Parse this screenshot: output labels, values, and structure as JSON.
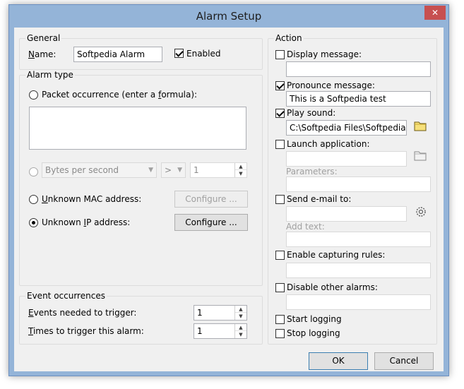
{
  "window": {
    "title": "Alarm Setup",
    "close_glyph": "✕"
  },
  "general": {
    "legend": "General",
    "name_label": "Name:",
    "name_value": "Softpedia Alarm",
    "enabled_label": "Enabled",
    "enabled": true
  },
  "alarm_type": {
    "legend": "Alarm type",
    "packet_label": "Packet occurrence (enter a formula):",
    "formula": "",
    "bytes_select": "Bytes per second",
    "operator_select": ">",
    "threshold_value": "1",
    "unknown_mac_label": "Unknown MAC address:",
    "unknown_mac_configure": "Configure ...",
    "unknown_ip_label": "Unknown IP address:",
    "unknown_ip_configure": "Configure ...",
    "selected": "unknown_ip"
  },
  "event_occurrences": {
    "legend": "Event occurrences",
    "events_label": "Events needed to trigger:",
    "events_value": "1",
    "times_label": "Times to trigger this alarm:",
    "times_value": "1"
  },
  "action": {
    "legend": "Action",
    "display_message_label": "Display message:",
    "display_message_value": "",
    "pronounce_message_label": "Pronounce message:",
    "pronounce_message_value": "This is a Softpedia test",
    "play_sound_label": "Play sound:",
    "play_sound_value": "C:\\Softpedia Files\\Softpedia.wav",
    "launch_app_label": "Launch application:",
    "launch_app_value": "",
    "parameters_label": "Parameters:",
    "parameters_value": "",
    "send_email_label": "Send e-mail to:",
    "send_email_value": "",
    "add_text_label": "Add text:",
    "add_text_value": "",
    "capturing_rules_label": "Enable capturing rules:",
    "capturing_rules_value": "",
    "disable_alarms_label": "Disable other alarms:",
    "disable_alarms_value": "",
    "start_logging_label": "Start logging",
    "stop_logging_label": "Stop logging"
  },
  "buttons": {
    "ok": "OK",
    "cancel": "Cancel"
  },
  "colors": {
    "title_bg": "#94b4d8",
    "close_bg": "#c75050",
    "folder": "#f6e07a"
  }
}
